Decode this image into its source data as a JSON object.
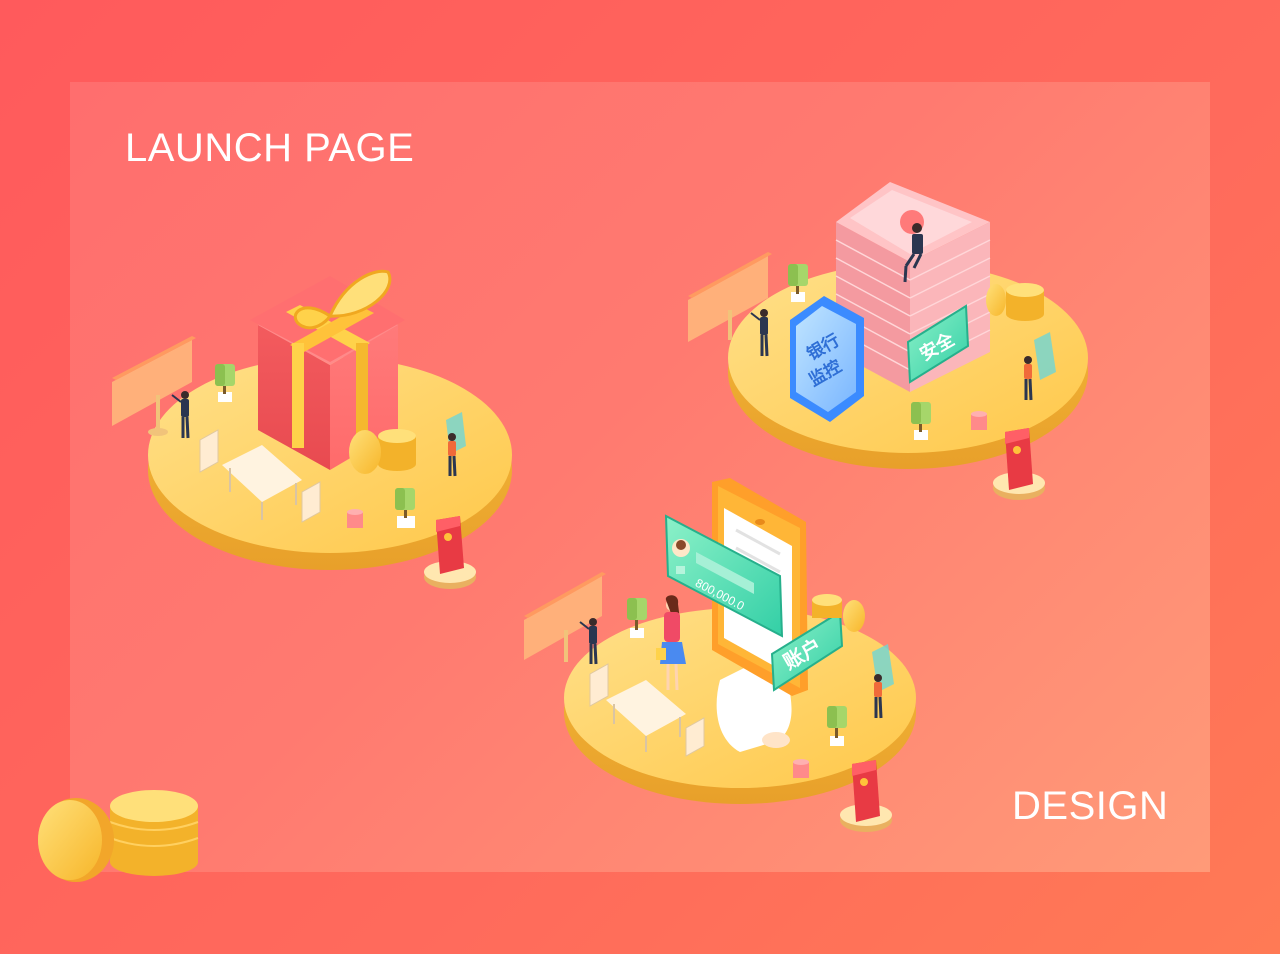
{
  "header": {
    "title": "LAUNCH PAGE"
  },
  "footer": {
    "label": "DESIGN"
  },
  "scene_gift": {
    "icon": "gift-box-icon"
  },
  "scene_bank": {
    "shield_line1": "银行",
    "shield_line2": "监控",
    "badge": "安全",
    "icon": "money-stack-icon"
  },
  "scene_account": {
    "card_amount": "800,000.0",
    "badge": "账户",
    "icon": "phone-icon"
  },
  "colors": {
    "background": "#ff5a5c",
    "panel": "#ff7a70",
    "platform": "#ffd266",
    "gift": "#f0494f",
    "ribbon": "#ffd24a",
    "money": "#f9b8bc",
    "shield": "#6fb6ff",
    "green_card": "#3fd6b0",
    "phone": "#ffb637"
  }
}
